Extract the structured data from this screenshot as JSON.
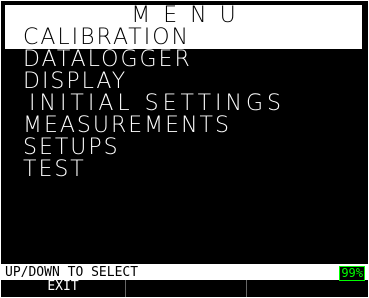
{
  "menu": {
    "title": "MENU",
    "items": [
      {
        "label": "CALIBRATION",
        "selected": true
      },
      {
        "label": "DATALOGGER",
        "selected": false
      },
      {
        "label": "DISPLAY",
        "selected": false
      },
      {
        "label": "INITIAL SETTINGS",
        "selected": false
      },
      {
        "label": "MEASUREMENTS",
        "selected": false
      },
      {
        "label": "SETUPS",
        "selected": false
      },
      {
        "label": "TEST",
        "selected": false
      }
    ]
  },
  "status": {
    "hint": "UP/DOWN TO SELECT",
    "battery": "99%",
    "battery_color": "#00ff00"
  },
  "softkeys": [
    "EXIT",
    "",
    ""
  ]
}
